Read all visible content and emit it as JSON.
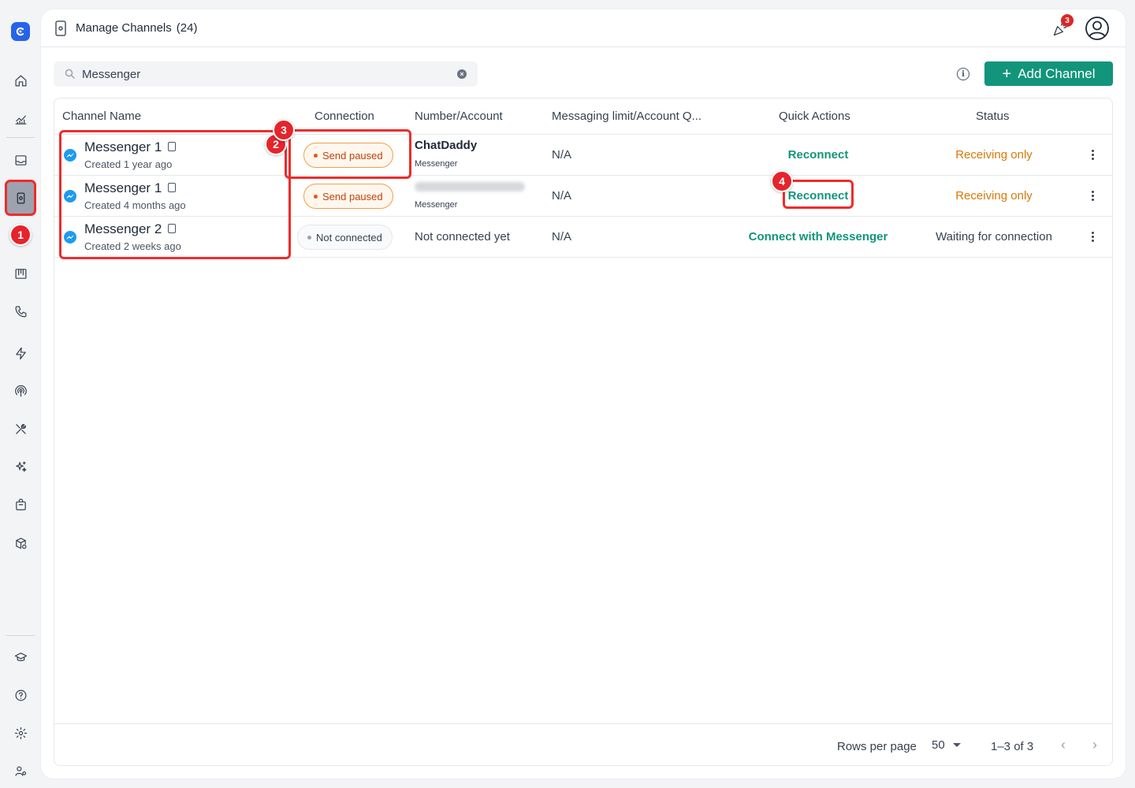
{
  "header": {
    "title": "Manage Channels",
    "count": "(24)",
    "notification_count": "3"
  },
  "search": {
    "value": "Messenger",
    "placeholder": "Search"
  },
  "toolbar": {
    "add_label": "Add Channel",
    "add_plus": "+"
  },
  "table": {
    "columns": [
      "Channel Name",
      "Connection",
      "Number/Account",
      "Messaging limit/Account Q...",
      "Quick Actions",
      "Status"
    ],
    "rows": [
      {
        "name": "Messenger 1",
        "created": "Created 1 year ago",
        "connection": "Send paused",
        "account": "ChatDaddy",
        "account_type": "Messenger",
        "limit": "N/A",
        "action": "Reconnect",
        "status": "Receiving only"
      },
      {
        "name": "Messenger 1",
        "created": "Created 4 months ago",
        "connection": "Send paused",
        "account": "",
        "account_type": "Messenger",
        "limit": "N/A",
        "action": "Reconnect",
        "status": "Receiving only"
      },
      {
        "name": "Messenger 2",
        "created": "Created 2 weeks ago",
        "connection": "Not connected",
        "account": "Not connected yet",
        "account_type": "",
        "limit": "N/A",
        "action": "Connect with Messenger",
        "status": "Waiting for connection"
      }
    ]
  },
  "pagination": {
    "rows_per_page_label": "Rows per page",
    "rows_per_page": "50",
    "range": "1–3 of 3",
    "prev": "‹",
    "next": "›"
  },
  "annotations": {
    "step1": "1",
    "step2": "2",
    "step3": "3",
    "step4": "4"
  },
  "colors": {
    "accent": "#12957a",
    "warning": "#d97706",
    "highlight": "#ef2b2b",
    "brand": "#2563eb"
  },
  "sidebar": {
    "icons": [
      "logo-icon",
      "home-icon",
      "analytics-icon",
      "inbox-icon",
      "channels-icon",
      "board-icon",
      "phone-icon",
      "automation-icon",
      "broadcast-icon",
      "tools-icon",
      "ai-icon",
      "shop-icon",
      "package-settings-icon",
      "academy-icon",
      "help-icon",
      "settings-icon",
      "team-icon"
    ]
  }
}
